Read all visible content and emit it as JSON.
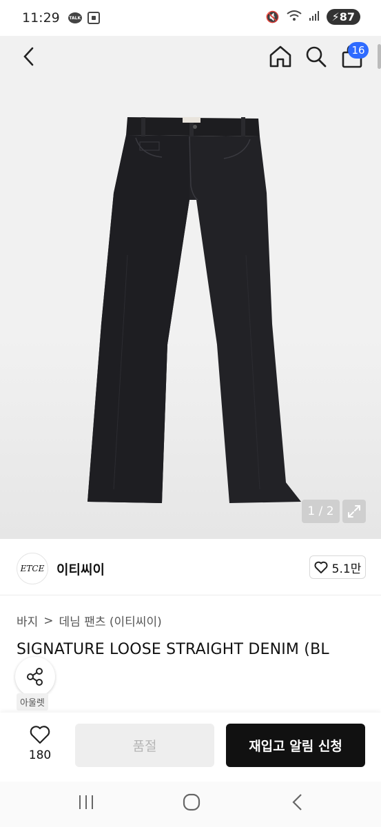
{
  "status_bar": {
    "time": "11:29",
    "talk_icon_text": "TALK",
    "battery": "87"
  },
  "icons": {
    "back": "chevron-left-icon",
    "home": "home-icon",
    "search": "search-icon",
    "cart": "shopping-bag-icon",
    "expand": "expand-icon",
    "heart": "heart-icon",
    "share": "share-icon"
  },
  "header": {
    "cart_count": "16"
  },
  "gallery": {
    "pager": "1 / 2"
  },
  "brand": {
    "logo_text": "ETCE",
    "name": "이티씨이",
    "likes": "5.1만"
  },
  "breadcrumb": {
    "items": [
      "바지",
      "데님 팬츠 (이티씨이)"
    ],
    "separator": ">"
  },
  "product": {
    "title": "SIGNATURE LOOSE STRAIGHT DENIM (BL",
    "badge": "아울렛"
  },
  "bottom_bar": {
    "wish_count": "180",
    "soldout_label": "품절",
    "restock_label": "재입고 알림 신청"
  },
  "colors": {
    "badge_blue": "#2f6bff",
    "primary_button": "#111111",
    "disabled_button": "#eeeeee",
    "hero_background": "#f1f1f1",
    "denim": "#1f1f22"
  }
}
